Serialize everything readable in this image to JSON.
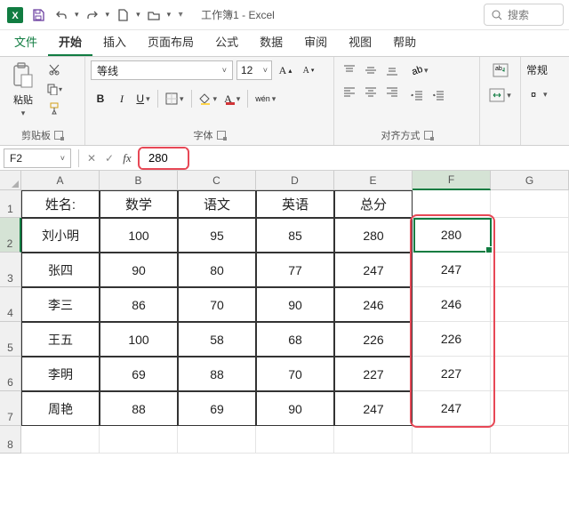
{
  "app": {
    "title": "工作簿1 - Excel"
  },
  "search": {
    "placeholder": "搜索"
  },
  "tabs": {
    "file": "文件",
    "home": "开始",
    "insert": "插入",
    "layout": "页面布局",
    "formulas": "公式",
    "data": "数据",
    "review": "审阅",
    "view": "视图",
    "help": "帮助"
  },
  "ribbon": {
    "clipboard": {
      "paste": "粘贴",
      "label": "剪贴板"
    },
    "font": {
      "name": "等线",
      "size": "12",
      "label": "字体",
      "wen": "wén"
    },
    "alignment": {
      "label": "对齐方式"
    },
    "number": {
      "general": "常规"
    }
  },
  "fxbar": {
    "cell_ref": "F2",
    "formula": "280"
  },
  "columns": [
    "A",
    "B",
    "C",
    "D",
    "E",
    "F",
    "G"
  ],
  "rows": [
    "1",
    "2",
    "3",
    "4",
    "5",
    "6",
    "7",
    "8"
  ],
  "table": {
    "headers": [
      "姓名:",
      "数学",
      "语文",
      "英语",
      "总分"
    ],
    "rows": [
      {
        "name": "刘小明",
        "math": "100",
        "chinese": "95",
        "english": "85",
        "total": "280",
        "f": "280"
      },
      {
        "name": "张四",
        "math": "90",
        "chinese": "80",
        "english": "77",
        "total": "247",
        "f": "247"
      },
      {
        "name": "李三",
        "math": "86",
        "chinese": "70",
        "english": "90",
        "total": "246",
        "f": "246"
      },
      {
        "name": "王五",
        "math": "100",
        "chinese": "58",
        "english": "68",
        "total": "226",
        "f": "226"
      },
      {
        "name": "李明",
        "math": "69",
        "chinese": "88",
        "english": "70",
        "total": "227",
        "f": "227"
      },
      {
        "name": "周艳",
        "math": "88",
        "chinese": "69",
        "english": "90",
        "total": "247",
        "f": "247"
      }
    ]
  },
  "active_cell": "F2",
  "colors": {
    "accent": "#107c41",
    "highlight": "#e74856"
  }
}
